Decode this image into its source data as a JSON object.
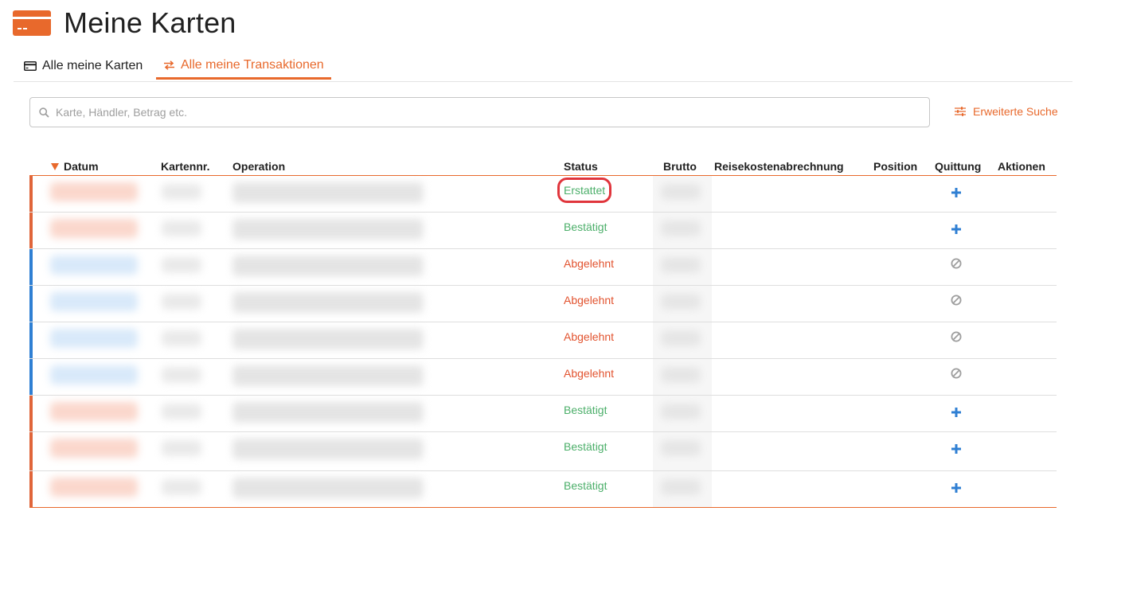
{
  "page": {
    "title": "Meine Karten",
    "accent_color": "#e8692c",
    "icon": "credit-card-icon"
  },
  "tabs": [
    {
      "label": "Alle meine Karten",
      "icon": "credit-card-icon",
      "active": false
    },
    {
      "label": "Alle meine Transaktionen",
      "icon": "swap-arrows-icon",
      "active": true
    }
  ],
  "search": {
    "placeholder": "Karte, Händler, Betrag etc.",
    "value": "",
    "advanced_label": "Erweiterte Suche",
    "advanced_icon": "sliders-icon"
  },
  "table": {
    "sort_icon": "sort-desc-icon",
    "columns": [
      "Datum",
      "Kartennr.",
      "Operation",
      "Status",
      "Brutto",
      "Reisekostenabrechnung",
      "Position",
      "Quittung",
      "Aktionen"
    ],
    "rows": [
      {
        "status": "Erstattet",
        "status_color": "#4caf6a",
        "bar_color": "#e0653a",
        "receipt_icon": "plus-icon",
        "highlighted": true
      },
      {
        "status": "Bestätigt",
        "status_color": "#4caf6a",
        "bar_color": "#e0653a",
        "receipt_icon": "plus-icon",
        "highlighted": false
      },
      {
        "status": "Abgelehnt",
        "status_color": "#e2532f",
        "bar_color": "#2f7fd3",
        "receipt_icon": "block-icon",
        "highlighted": false
      },
      {
        "status": "Abgelehnt",
        "status_color": "#e2532f",
        "bar_color": "#2f7fd3",
        "receipt_icon": "block-icon",
        "highlighted": false
      },
      {
        "status": "Abgelehnt",
        "status_color": "#e2532f",
        "bar_color": "#2f7fd3",
        "receipt_icon": "block-icon",
        "highlighted": false
      },
      {
        "status": "Abgelehnt",
        "status_color": "#e2532f",
        "bar_color": "#2f7fd3",
        "receipt_icon": "block-icon",
        "highlighted": false
      },
      {
        "status": "Bestätigt",
        "status_color": "#4caf6a",
        "bar_color": "#e0653a",
        "receipt_icon": "plus-icon",
        "highlighted": false
      },
      {
        "status": "Bestätigt",
        "status_color": "#4caf6a",
        "bar_color": "#e0653a",
        "receipt_icon": "plus-icon",
        "highlighted": false
      },
      {
        "status": "Bestätigt",
        "status_color": "#4caf6a",
        "bar_color": "#e0653a",
        "receipt_icon": "plus-icon",
        "highlighted": false
      }
    ]
  }
}
